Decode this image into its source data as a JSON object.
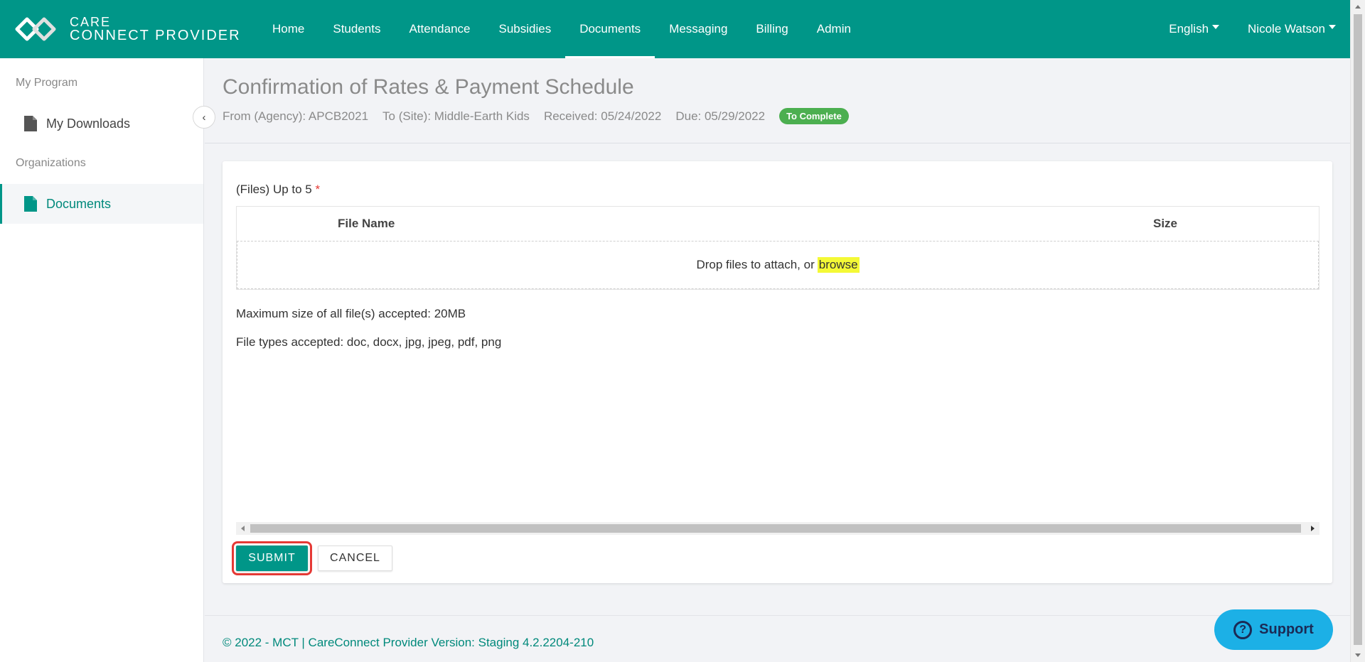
{
  "brand": {
    "line1": "CARE",
    "line2": "CONNECT PROVIDER"
  },
  "nav": {
    "items": [
      {
        "label": "Home"
      },
      {
        "label": "Students"
      },
      {
        "label": "Attendance"
      },
      {
        "label": "Subsidies"
      },
      {
        "label": "Documents",
        "active": true
      },
      {
        "label": "Messaging"
      },
      {
        "label": "Billing"
      },
      {
        "label": "Admin"
      }
    ],
    "language": "English",
    "user": "Nicole Watson"
  },
  "sidebar": {
    "section1": "My Program",
    "item1": "My Downloads",
    "section2": "Organizations",
    "item2": "Documents"
  },
  "header": {
    "title": "Confirmation of Rates & Payment Schedule",
    "from": "From (Agency): APCB2021",
    "to": "To (Site): Middle-Earth Kids",
    "received": "Received: 05/24/2022",
    "due": "Due: 05/29/2022",
    "status": "To Complete"
  },
  "form": {
    "files_label": "(Files) Up to 5",
    "required_mark": "*",
    "col_name": "File Name",
    "col_size": "Size",
    "drop_text": "Drop files to attach, or",
    "browse": "browse",
    "max_size": "Maximum size of all file(s) accepted: 20MB",
    "file_types": "File types accepted: doc, docx, jpg, jpeg, pdf, png",
    "submit": "SUBMIT",
    "cancel": "CANCEL"
  },
  "footer": {
    "text": "© 2022 - MCT | CareConnect Provider Version: Staging 4.2.2204-210"
  },
  "support": {
    "label": "Support"
  },
  "colors": {
    "primary": "#009688",
    "badge": "#4caf50",
    "support": "#1cb0e6",
    "highlight": "#e53935"
  }
}
